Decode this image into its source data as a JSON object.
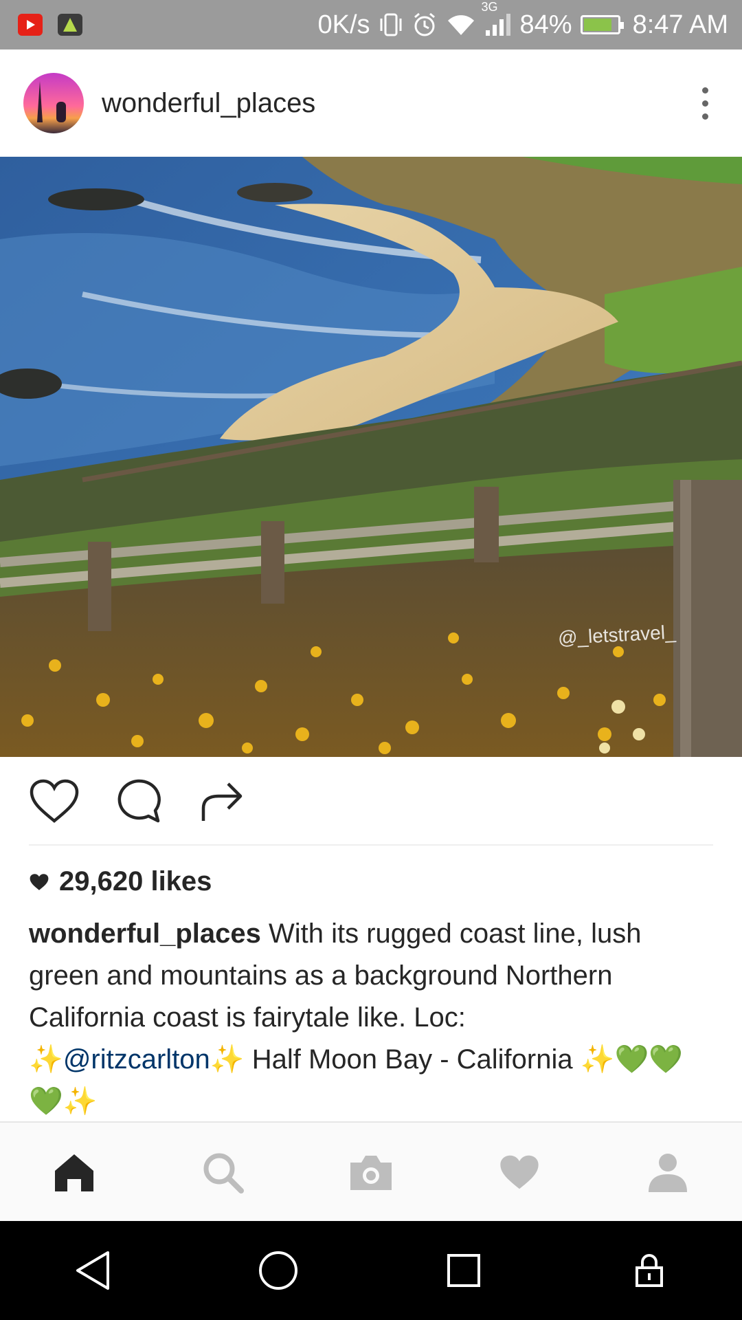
{
  "status_bar": {
    "speed": "0K/s",
    "network": "3G",
    "battery": "84%",
    "battery_level": 0.84,
    "time": "8:47 AM",
    "icons": [
      "youtube-icon",
      "apk-icon",
      "vibrate-icon",
      "alarm-icon",
      "wifi-icon",
      "signal-icon",
      "battery-icon"
    ]
  },
  "post": {
    "username": "wonderful_places",
    "watermark": "@_letstravel_",
    "likes": "29,620 likes",
    "caption": {
      "username": "wonderful_places",
      "text": "With its rugged coast line, lush green and mountains as a background Northern California coast is fairytale like. Loc:",
      "mention": "@ritzcarlton",
      "location": "Half Moon Bay - California",
      "sparkle": "✨",
      "green_heart": "💚"
    }
  },
  "actions": [
    "heart-icon",
    "comment-icon",
    "share-icon"
  ],
  "tabs": [
    "home-icon",
    "search-icon",
    "camera-icon",
    "activity-heart-icon",
    "profile-icon"
  ],
  "nav": [
    "back-icon",
    "home-circle-icon",
    "recents-icon",
    "lock-icon"
  ],
  "colors": {
    "status_bar": "#9b9b9b",
    "mention": "#003569",
    "tab_bar": "#fafafa"
  }
}
